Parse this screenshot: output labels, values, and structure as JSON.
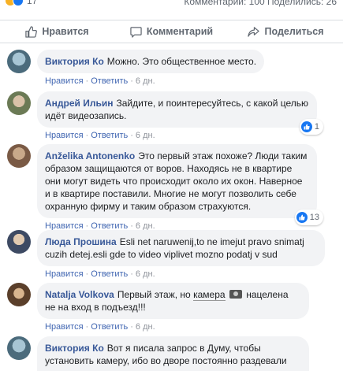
{
  "top": {
    "reaction_count": "17",
    "stats": "Комментарии: 100  Поделились: 26"
  },
  "actions": {
    "like": "Нравится",
    "comment": "Комментарий",
    "share": "Поделиться"
  },
  "meta_labels": {
    "like": "Нравится",
    "reply": "Ответить",
    "dot": "·"
  },
  "comments": [
    {
      "author": "Виктория Ко",
      "text": "Можно. Это общественное место.",
      "time": "6 дн."
    },
    {
      "author": "Андрей Ильин",
      "text": "Зайдите, и поинтересуйтесь, с какой целью идёт видеозапись.",
      "time": "6 дн.",
      "likes": "1"
    },
    {
      "author": "Anželika Antonenko",
      "text": "Это первый этаж похоже? Люди таким образом защищаются от воров. Находясь не в квартире они могут видеть что происходит около их окон. Наверное и в квартире поставили. Многие не могут позволить себе охранную фирму и таким образом страхуются.",
      "time": "6 дн.",
      "likes": "13"
    },
    {
      "author": "Люда Прошина",
      "text": "Esli net naruwenij,to ne imejut pravo snimatj cuzih detej.esli gde to video viplivet mozno podatj v sud",
      "time": "6 дн."
    },
    {
      "author": "Natalja Volkova",
      "text_before": "Первый этаж, но",
      "text_link": "камера",
      "text_after": "нацелена не на вход в подъезд!!!",
      "time": "6 дн."
    },
    {
      "author": "Виктория Ко",
      "text": "Вот я писала запрос в Думу, чтобы установить камеру, ибо во дворе постоянно раздевали машину."
    }
  ],
  "colors": {
    "author": "#385898",
    "link": "#4267b2",
    "bubble": "#f2f3f5",
    "like_blue": "#1877f2"
  }
}
